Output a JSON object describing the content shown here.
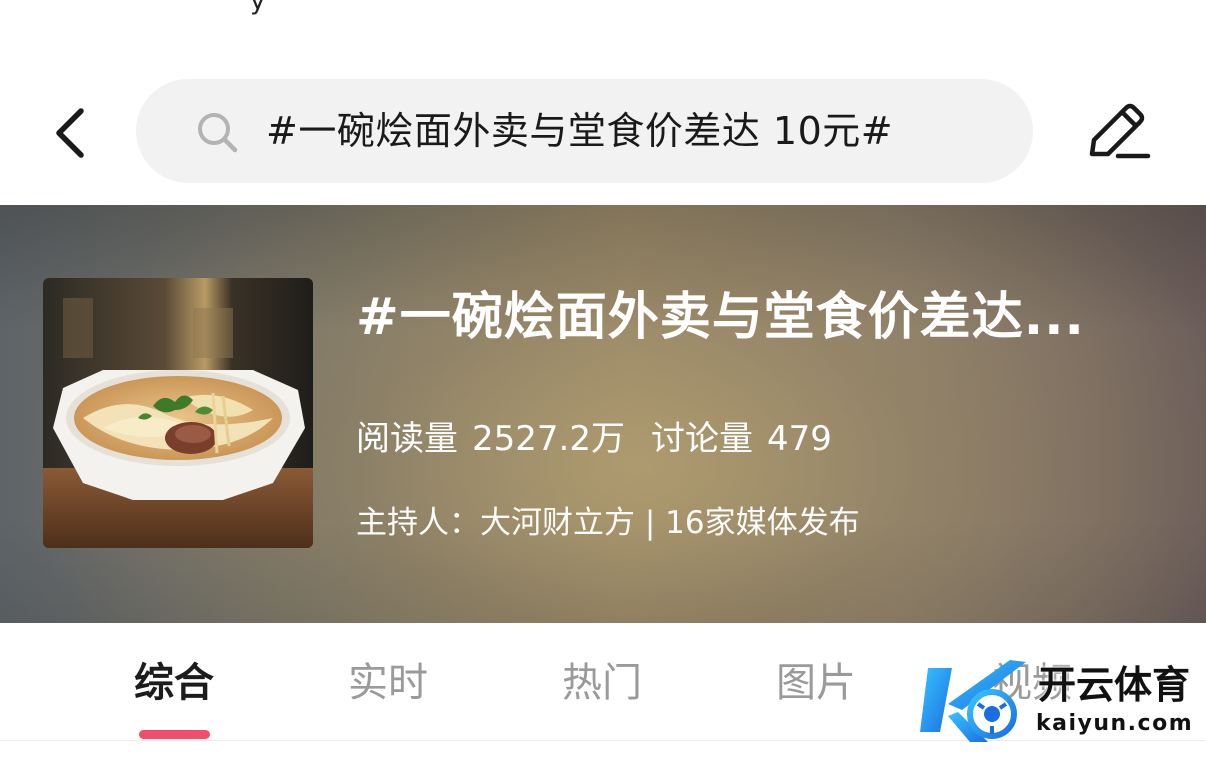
{
  "status_fragment": "y",
  "header": {
    "back_icon": "chevron-left-icon",
    "search": {
      "icon": "search-icon",
      "query": "#一碗烩面外卖与堂食价差达 10元#"
    },
    "edit_icon": "pencil-icon"
  },
  "topic": {
    "title": "#一碗烩面外卖与堂食价差达...",
    "reads_label": "阅读量",
    "reads_value": "2527.2万",
    "discussions_label": "讨论量",
    "discussions_value": "479",
    "host_line": "主持人：大河财立方 | 16家媒体发布"
  },
  "tabs": [
    {
      "label": "综合",
      "active": true
    },
    {
      "label": "实时",
      "active": false
    },
    {
      "label": "热门",
      "active": false
    },
    {
      "label": "图片",
      "active": false
    },
    {
      "label": "视频",
      "active": false
    }
  ],
  "watermark": {
    "brand": "开云体育",
    "url": "kaiyun.com"
  },
  "colors": {
    "tab_indicator": "#f24d6b",
    "search_bg": "#f2f2f2",
    "active_tab": "#1c1c1c",
    "inactive_tab": "#9a9a9a"
  }
}
